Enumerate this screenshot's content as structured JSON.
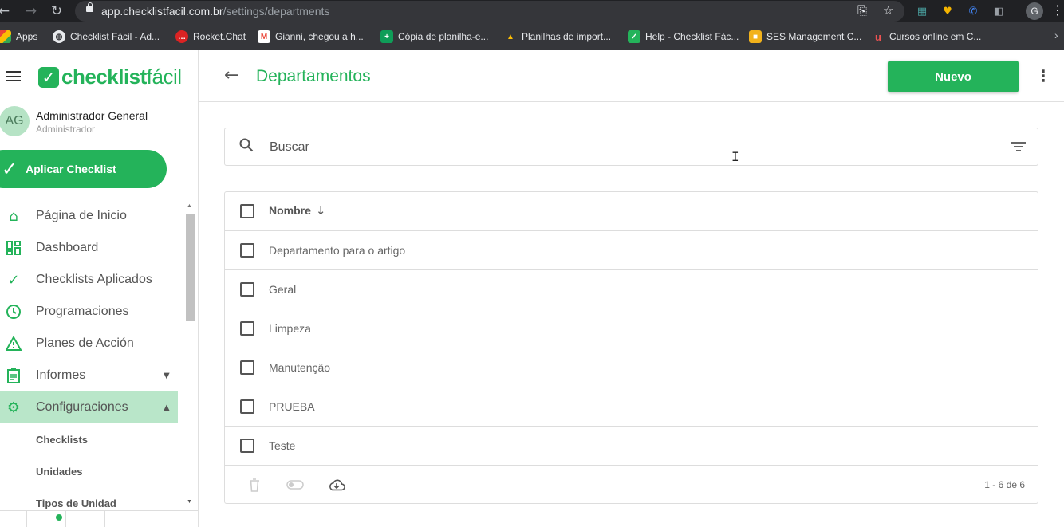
{
  "browser": {
    "url_host": "app.checklistfacil.com.br",
    "url_path": "/settings/departments",
    "profile_initial": "G",
    "bookmarks": [
      {
        "label": "Apps",
        "icon": "apps-grid-icon",
        "color": "#ea4335"
      },
      {
        "label": "Checklist Fácil - Ad...",
        "icon": "globe-icon",
        "color": "#9aa0a6"
      },
      {
        "label": "Rocket.Chat",
        "icon": "rocketchat-icon",
        "color": "#db2323"
      },
      {
        "label": "Gianni, chegou a h...",
        "icon": "gmail-icon",
        "color": "#ea4335"
      },
      {
        "label": "Cópia de planilha-e...",
        "icon": "sheets-icon",
        "color": "#0f9d58"
      },
      {
        "label": "Planilhas de import...",
        "icon": "drive-icon",
        "color": "#fbbc04"
      },
      {
        "label": "Help - Checklist Fác...",
        "icon": "checklist-icon",
        "color": "#24b35a"
      },
      {
        "label": "SES Management C...",
        "icon": "box-icon",
        "color": "#f2b21b"
      },
      {
        "label": "Cursos online em C...",
        "icon": "udemy-icon",
        "color": "#ec5252"
      }
    ]
  },
  "app": {
    "brand_color": "#24b35a",
    "logo": {
      "bold": "checklist",
      "light": "fácil"
    },
    "user": {
      "initials": "AG",
      "name": "Administrador General",
      "role": "Administrador"
    },
    "apply_button": "Aplicar Checklist",
    "menu": [
      {
        "label": "Página de Inicio",
        "icon": "home-icon"
      },
      {
        "label": "Dashboard",
        "icon": "dashboard-icon"
      },
      {
        "label": "Checklists Aplicados",
        "icon": "check-icon"
      },
      {
        "label": "Programaciones",
        "icon": "clock-icon"
      },
      {
        "label": "Planes de Acción",
        "icon": "warning-icon"
      },
      {
        "label": "Informes",
        "icon": "clipboard-icon"
      },
      {
        "label": "Configuraciones",
        "icon": "gear-icon"
      }
    ],
    "submenu": [
      "Checklists",
      "Unidades",
      "Tipos de Unidad"
    ]
  },
  "page": {
    "title": "Departamentos",
    "new_button": "Nuevo",
    "search_placeholder": "Buscar",
    "table": {
      "header": "Nombre",
      "rows": [
        "Departamento para o artigo",
        "Geral",
        "Limpeza",
        "Manutenção",
        "PRUEBA",
        "Teste"
      ],
      "pager": "1 - 6 de 6"
    }
  }
}
